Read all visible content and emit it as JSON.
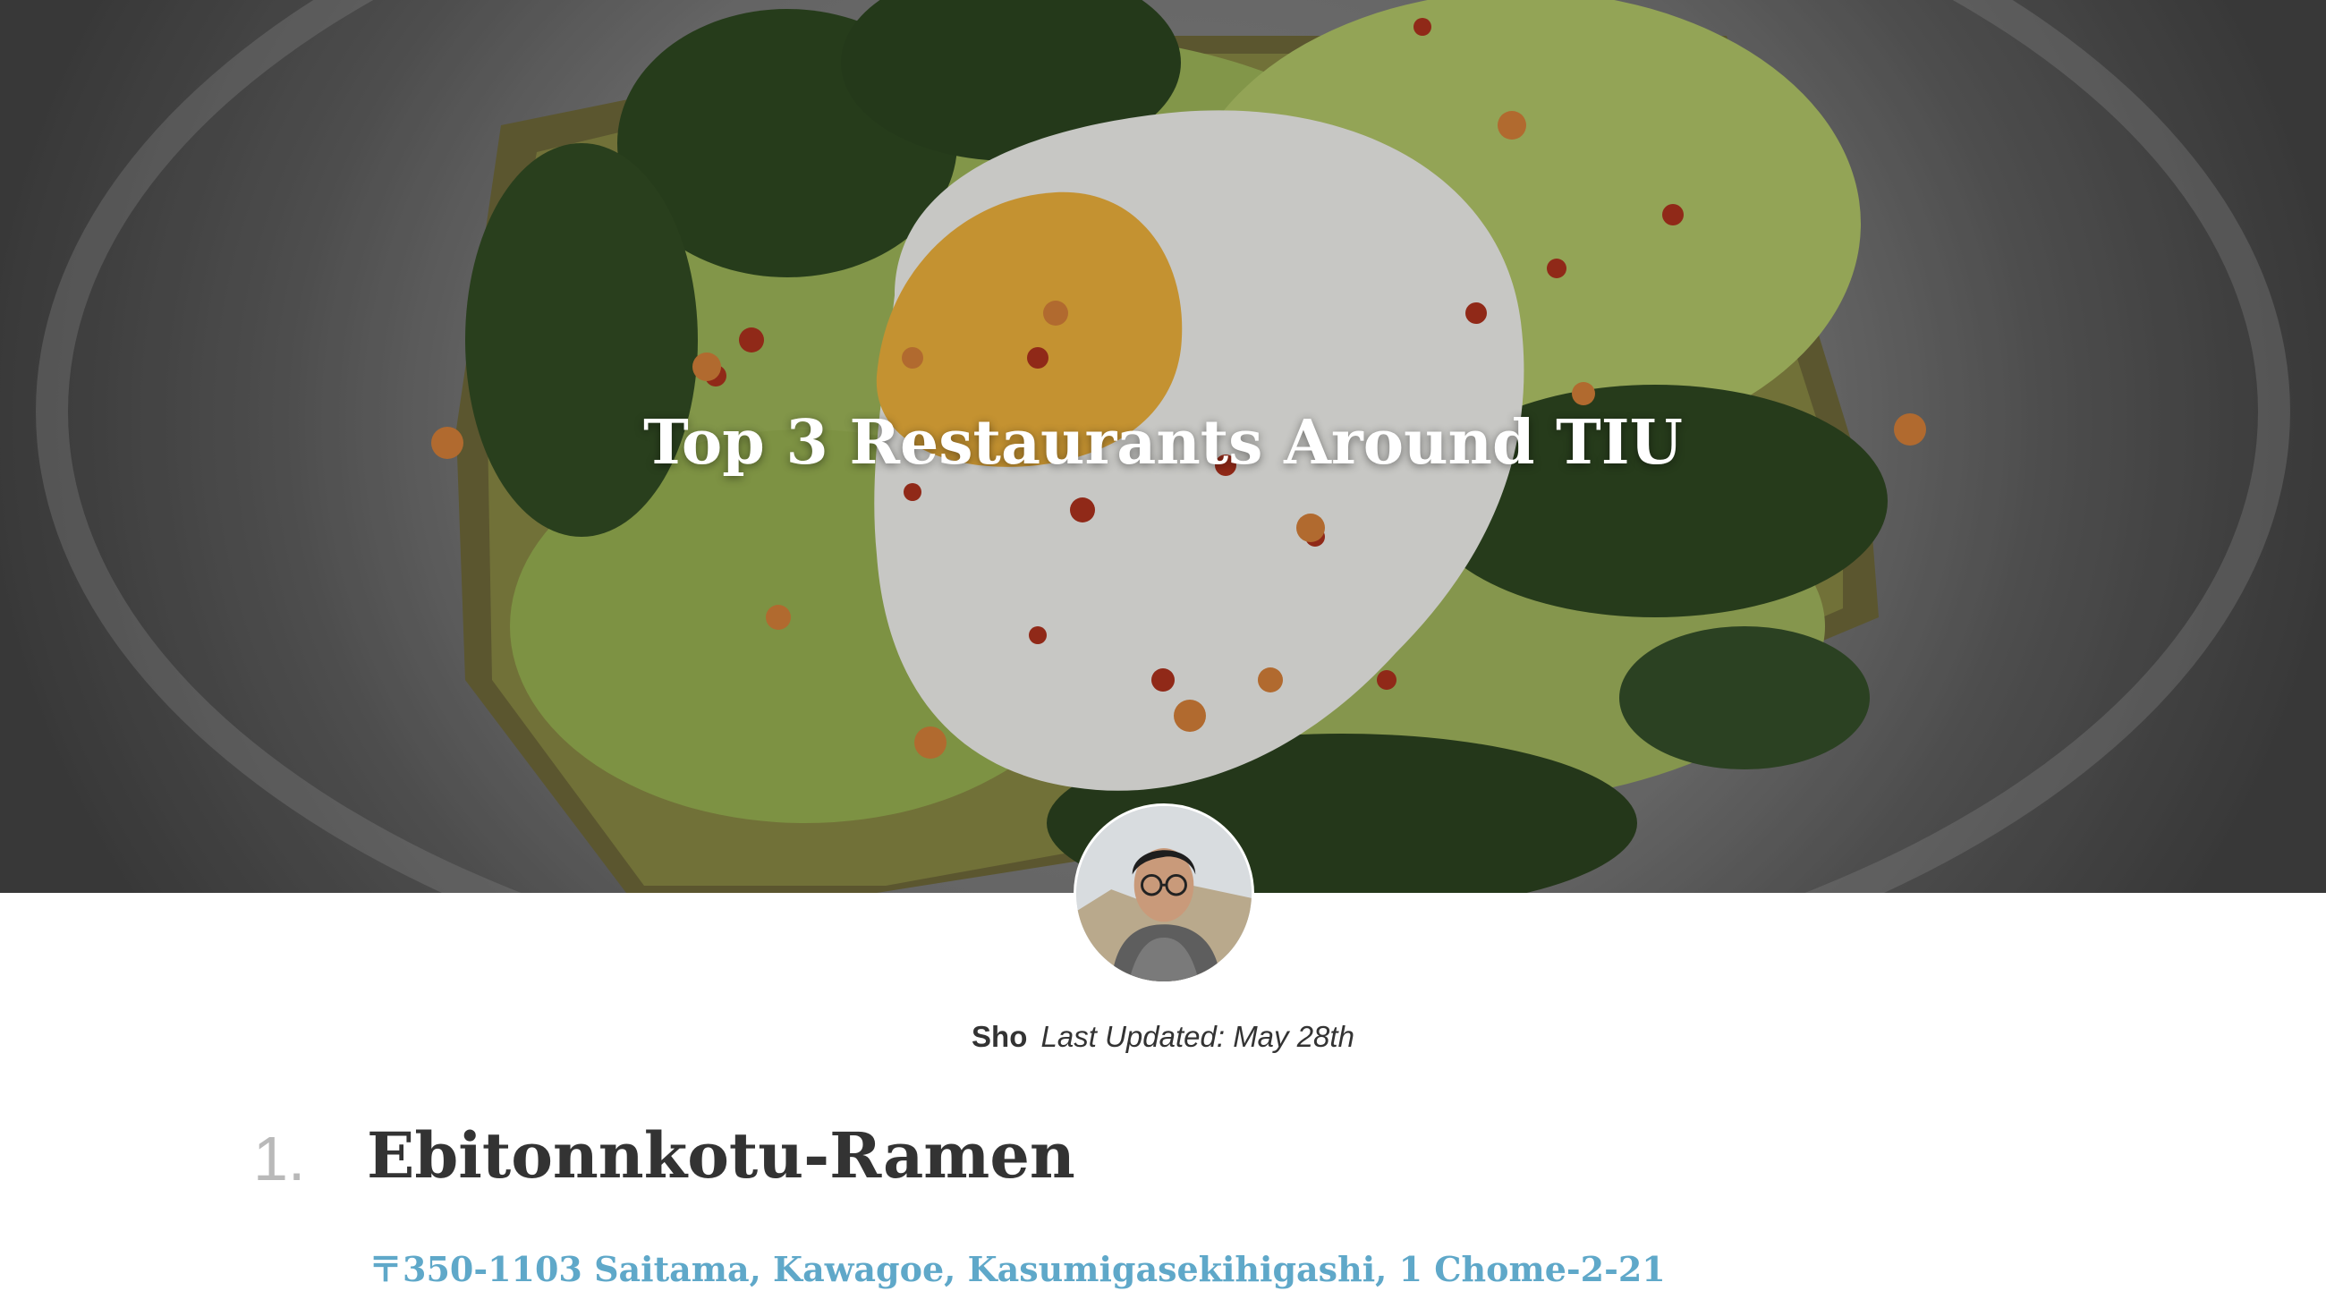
{
  "hero": {
    "title": "Top 3 Restaurants Around TIU"
  },
  "byline": {
    "author": "Sho",
    "last_updated": "Last Updated: May 28th"
  },
  "restaurants": [
    {
      "number": "1.",
      "name": "Ebitonnkotu-Ramen",
      "address": "〒350-1103 Saitama, Kawagoe, Kasumigasekihigashi, 1 Chome-2-21"
    }
  ],
  "colors": {
    "link": "#5fa8c9",
    "heading": "#333333",
    "number": "#b9b9b9"
  }
}
